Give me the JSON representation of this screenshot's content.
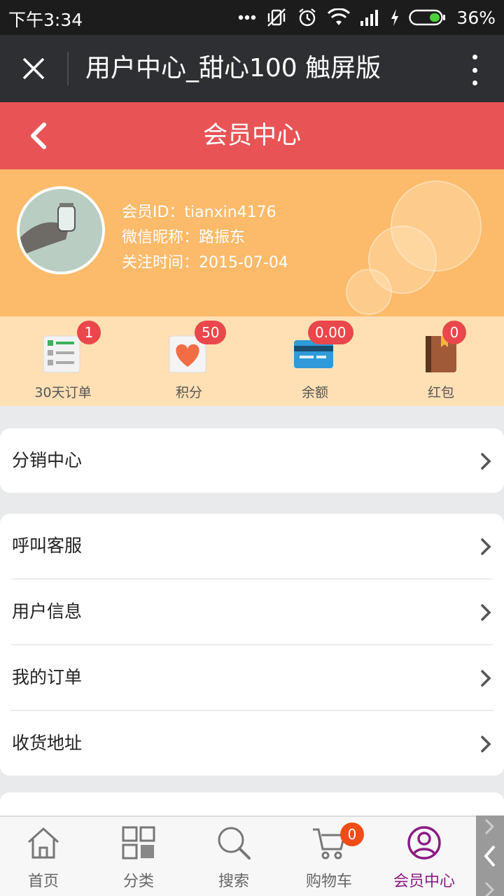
{
  "status_bar": {
    "time": "下午3:34",
    "battery": "36%"
  },
  "browser": {
    "title": "用户中心_甜心100 触屏版"
  },
  "header": {
    "title": "会员中心"
  },
  "profile": {
    "member_id": "会员ID：tianxin4176",
    "nickname": "微信昵称：路振东",
    "follow_time": "关注时间：2015-07-04"
  },
  "stats": [
    {
      "label": "30天订单",
      "badge": "1",
      "icon": "order-list-icon"
    },
    {
      "label": "积分",
      "badge": "50",
      "icon": "heart-icon"
    },
    {
      "label": "余额",
      "badge": "0.00",
      "icon": "card-icon"
    },
    {
      "label": "红包",
      "badge": "0",
      "icon": "red-packet-icon"
    }
  ],
  "menu": {
    "group1": [
      {
        "label": "分销中心"
      }
    ],
    "group2": [
      {
        "label": "呼叫客服"
      },
      {
        "label": "用户信息"
      },
      {
        "label": "我的订单"
      },
      {
        "label": "收货地址"
      }
    ]
  },
  "bottom_nav": [
    {
      "label": "首页",
      "icon": "home-icon"
    },
    {
      "label": "分类",
      "icon": "grid-icon"
    },
    {
      "label": "搜索",
      "icon": "search-icon"
    },
    {
      "label": "购物车",
      "icon": "cart-icon",
      "badge": "0"
    },
    {
      "label": "会员中心",
      "icon": "user-icon",
      "active": true
    }
  ],
  "colors": {
    "header": "#e85456",
    "profile_bg": "#fcba6b",
    "stats_bg": "#ffdfb4",
    "badge": "#e9474b",
    "active_nav": "#8b1a83"
  }
}
